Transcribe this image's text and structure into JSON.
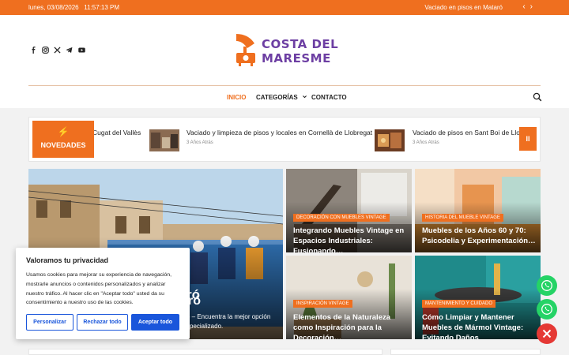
{
  "topbar": {
    "date": "lunes, 03/08/2026",
    "time": "11:57:13 PM",
    "ticker": "Vaciado en pisos en Mataró",
    "prev": "‹",
    "next": "›"
  },
  "brand": {
    "line1": "COSTA DEL",
    "line2": "MARESME",
    "purple": "#6d3fa3",
    "orange": "#ef6f1f"
  },
  "socials": [
    "facebook-icon",
    "instagram-icon",
    "x-icon",
    "telegram-icon",
    "youtube-icon"
  ],
  "nav": {
    "items": [
      {
        "label": "INICIO"
      },
      {
        "label": "CATEGORÍAS"
      },
      {
        "label": "CONTACTO"
      }
    ],
    "dropdown_caret": "⌄"
  },
  "newsbar": {
    "badge": "NOVEDADES",
    "bolt": "⚡",
    "pause": "II",
    "items": [
      {
        "title": "Cugat del Vallès",
        "ago": ""
      },
      {
        "title": "Vaciado y limpieza de pisos y locales en Cornellà de Llobregat",
        "ago": "3 Años Atrás"
      },
      {
        "title": "Vaciado de pisos en Sant Boi de Llobre",
        "ago": "3 Años Atrás"
      }
    ]
  },
  "grid": {
    "featured": {
      "title_fragment": "ró",
      "title_fragment2": "ró",
      "excerpt_line1": "ó – Encuentra la mejor opción",
      "excerpt_line2": "specializado."
    },
    "cards": [
      {
        "category": "Decoración con Muebles Vintage",
        "title": "Integrando Muebles Vintage en Espacios Industriales: Fusionando…"
      },
      {
        "category": "Historia del Mueble Vintage",
        "title": "Muebles de los Años 60 y 70: Psicodelia y Experimentación…"
      },
      {
        "category": "Inspiración Vintage",
        "title": "Elementos de la Naturaleza como Inspiración para la Decoración…"
      },
      {
        "category": "Mantenimiento y Cuidado",
        "title": "Cómo Limpiar y Mantener Muebles de Mármol Vintage: Evitando Daños"
      }
    ]
  },
  "cookie": {
    "title": "Valoramos tu privacidad",
    "body": "Usamos cookies para mejorar su experiencia de navegación, mostrarle anuncios o contenidos personalizados y analizar nuestro tráfico. Al hacer clic en \"Aceptar todo\" usted da su consentimiento a nuestro uso de las cookies.",
    "customize": "Personalizar",
    "reject": "Rechazar todo",
    "accept": "Aceptar todo"
  },
  "floating": {
    "whatsapp_green": "#25d366",
    "close_red": "#e53935"
  }
}
